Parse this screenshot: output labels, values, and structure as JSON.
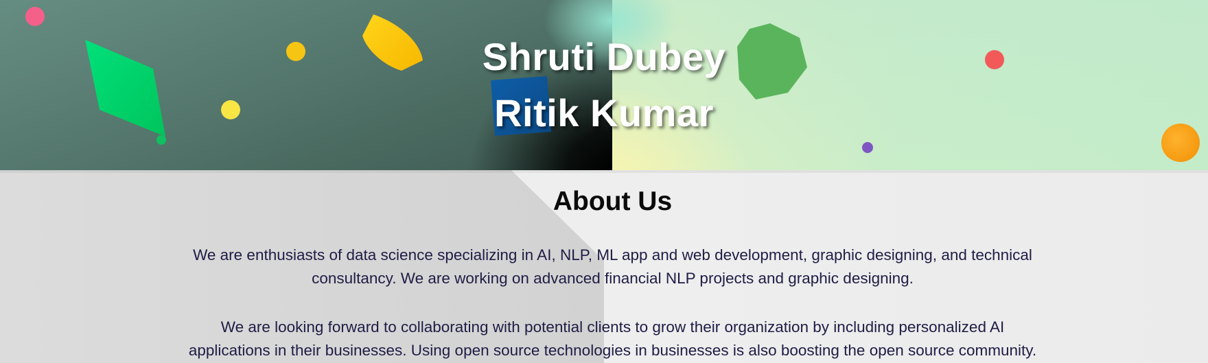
{
  "hero": {
    "names": [
      "Shruti Dubey",
      "Ritik Kumar"
    ]
  },
  "about": {
    "title": "About Us",
    "paragraphs": [
      "We are enthusiasts of data science specializing in AI, NLP, ML app and web development, graphic designing, and technical consultancy. We are working on advanced financial NLP projects and graphic designing.",
      "We are looking forward to collaborating with potential clients to grow their organization by including personalized AI applications in their businesses. Using open source technologies in businesses is also boosting the open source community."
    ]
  },
  "colors": {
    "name_text": "#ffffff",
    "title_text": "#0b0b0b",
    "body_text": "#1f1c45",
    "about_bg": "#ececec"
  }
}
